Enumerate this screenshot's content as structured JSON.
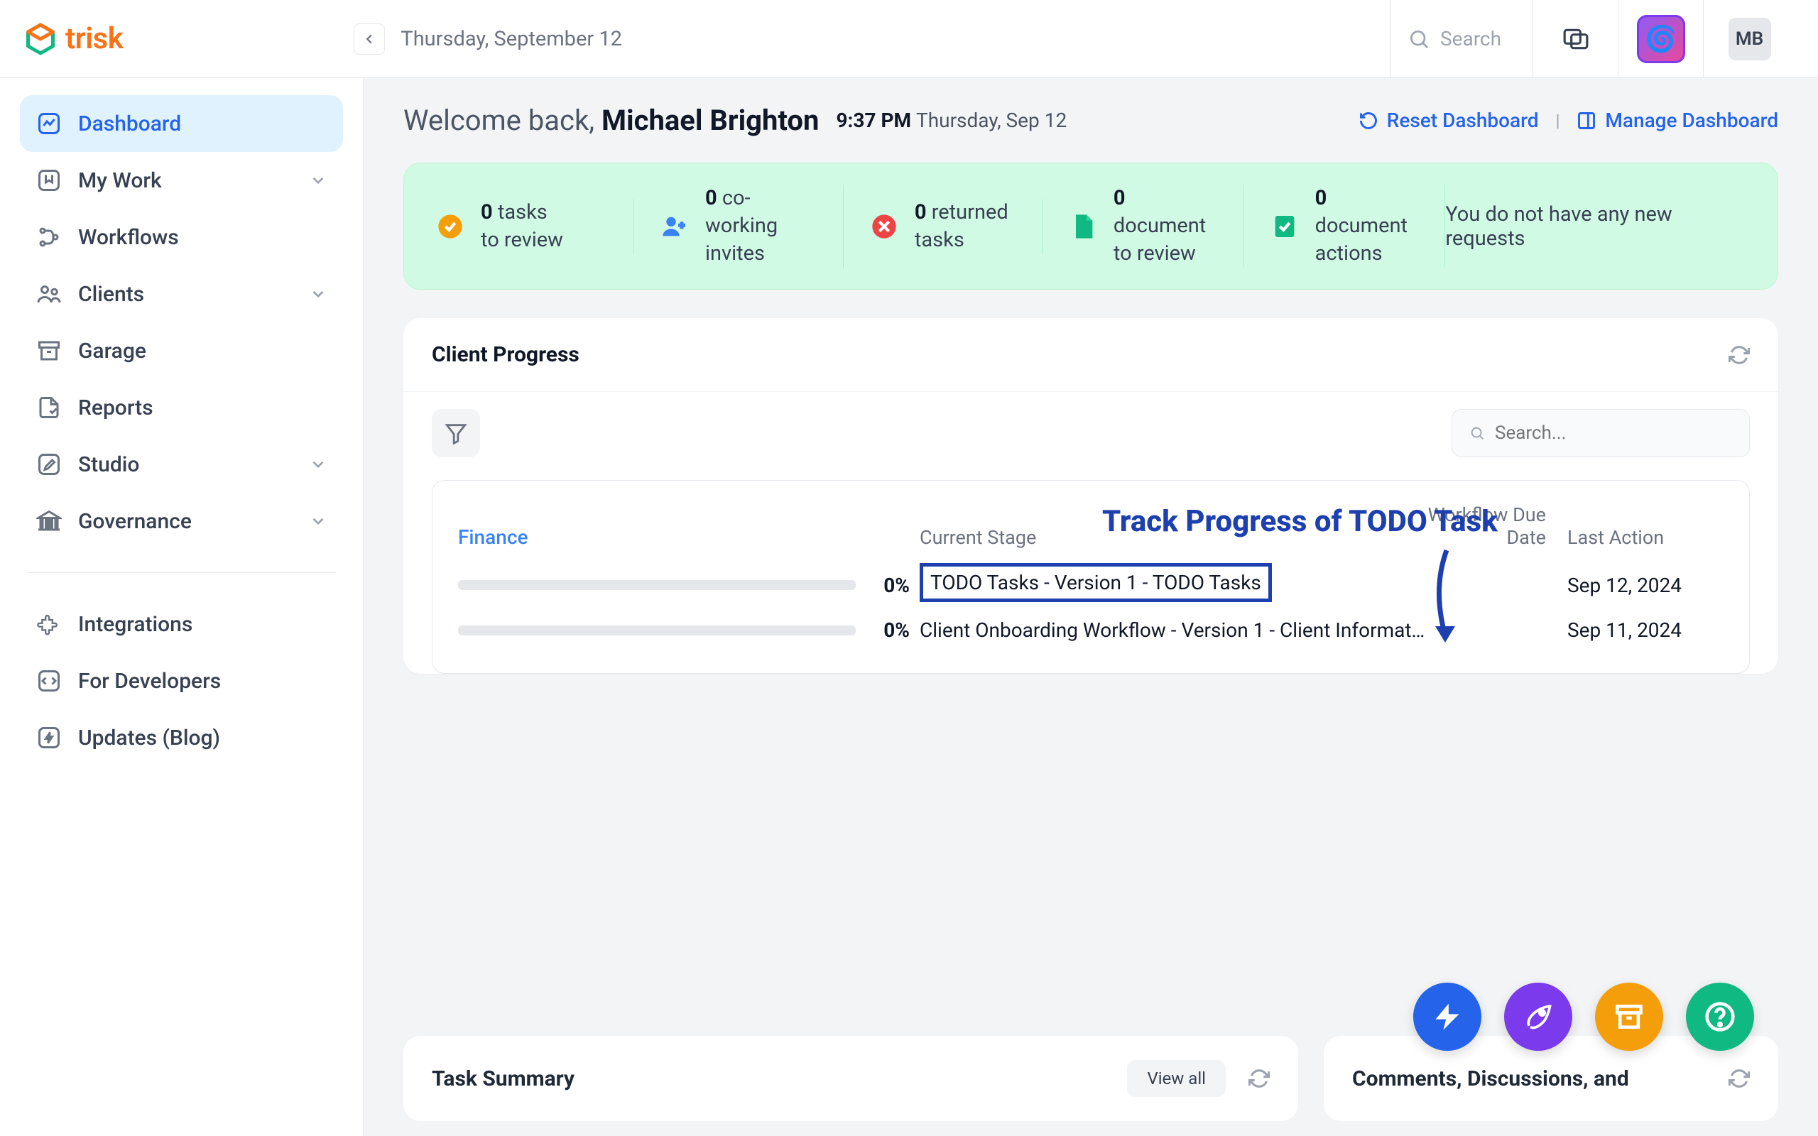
{
  "brand": {
    "name": "trisk"
  },
  "topbar": {
    "date": "Thursday, September 12",
    "search_label": "Search",
    "avatar_initials": "MB"
  },
  "sidebar": {
    "items": [
      {
        "label": "Dashboard",
        "icon": "chart-icon",
        "active": true,
        "chevron": false
      },
      {
        "label": "My Work",
        "icon": "bookmark-icon",
        "chevron": true
      },
      {
        "label": "Workflows",
        "icon": "branch-icon",
        "chevron": false
      },
      {
        "label": "Clients",
        "icon": "users-icon",
        "chevron": true
      },
      {
        "label": "Garage",
        "icon": "archive-icon",
        "chevron": false
      },
      {
        "label": "Reports",
        "icon": "file-icon",
        "chevron": false
      },
      {
        "label": "Studio",
        "icon": "pencil-icon",
        "chevron": true
      },
      {
        "label": "Governance",
        "icon": "bank-icon",
        "chevron": true
      }
    ],
    "items2": [
      {
        "label": "Integrations",
        "icon": "puzzle-icon"
      },
      {
        "label": "For Developers",
        "icon": "code-icon"
      },
      {
        "label": "Updates (Blog)",
        "icon": "bolt-icon"
      }
    ]
  },
  "welcome": {
    "prefix": "Welcome back, ",
    "name": "Michael Brighton",
    "time": "9:37 PM",
    "day": "Thursday, Sep 12",
    "reset": "Reset Dashboard",
    "manage": "Manage Dashboard"
  },
  "stats": {
    "tasks_review": {
      "n": "0",
      "line1": "tasks",
      "line2": "to review"
    },
    "coworking": {
      "n": "0",
      "line1": "co-working",
      "line2": "invites"
    },
    "returned": {
      "n": "0",
      "line1": "returned",
      "line2": "tasks"
    },
    "doc_review": {
      "n": "0",
      "line1": "document",
      "line2": "to review"
    },
    "doc_actions": {
      "n": "0",
      "line1": "document",
      "line2": "actions"
    },
    "no_requests": "You do not have any new requests"
  },
  "progress": {
    "title": "Client Progress",
    "search_placeholder": "Search...",
    "client": "Finance",
    "col_stage": "Current Stage",
    "col_due": "Workflow Due Date",
    "col_action": "Last Action",
    "rows": [
      {
        "pct": "0%",
        "stage": "TODO Tasks - Version 1 - TODO Tasks",
        "due": "",
        "action": "Sep 12, 2024",
        "boxed": true
      },
      {
        "pct": "0%",
        "stage": "Client Onboarding Workflow - Version 1 - Client Informat…",
        "due": "",
        "action": "Sep 11, 2024",
        "boxed": false
      }
    ]
  },
  "annotation": "Track Progress of TODO Task",
  "task_summary": {
    "title": "Task Summary",
    "view_all": "View all"
  },
  "comments": {
    "title": "Comments, Discussions, and"
  }
}
